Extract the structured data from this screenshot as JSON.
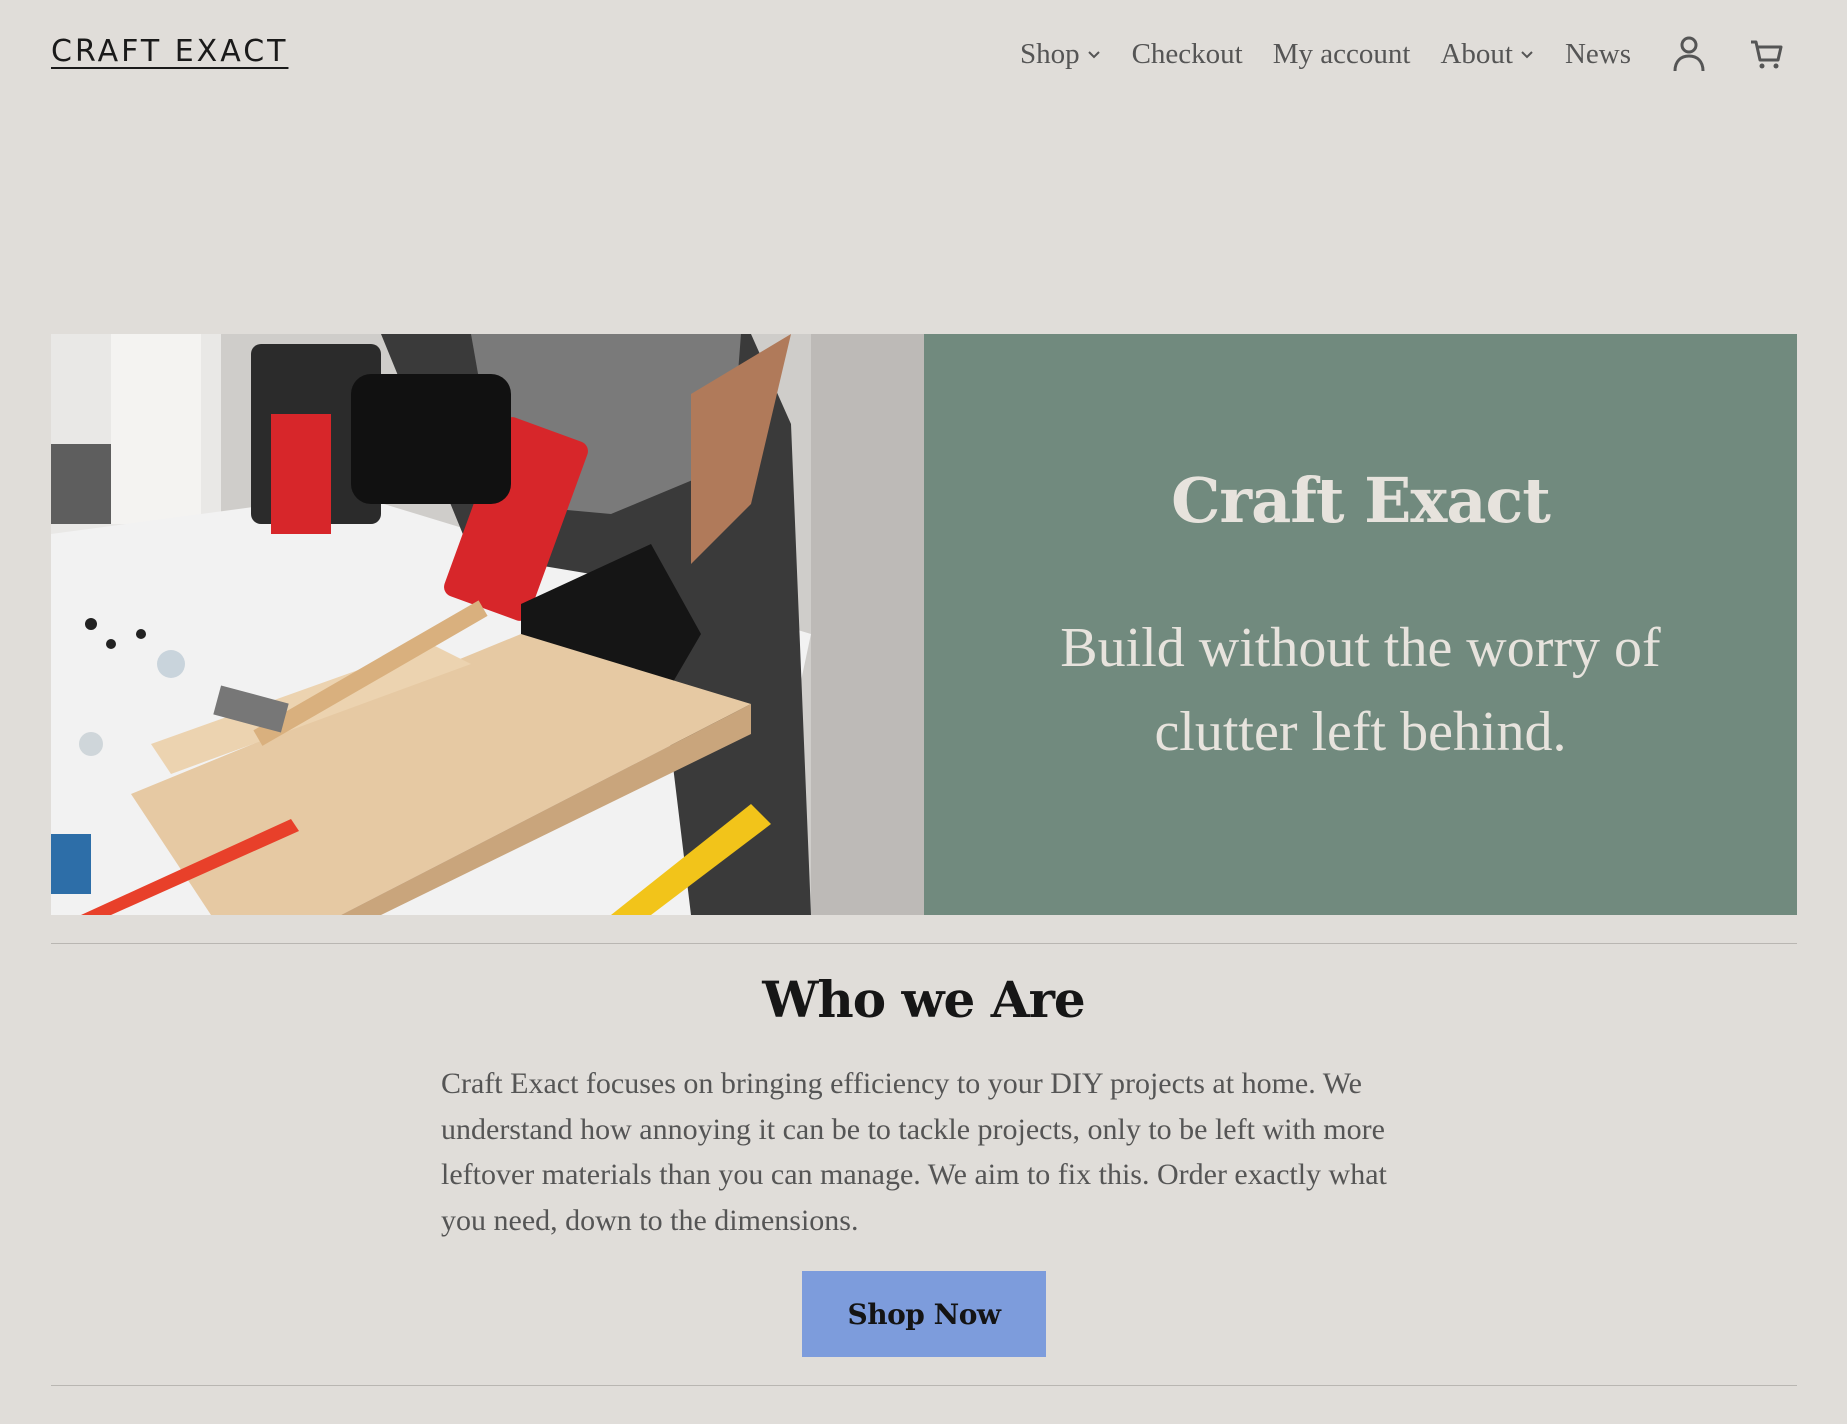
{
  "header": {
    "site_title": "CRAFT EXACT",
    "nav": {
      "shop": "Shop",
      "checkout": "Checkout",
      "my_account": "My account",
      "about": "About",
      "news": "News"
    },
    "icons": [
      "user-icon",
      "cart-icon",
      "chevron-down-icon"
    ]
  },
  "hero": {
    "title": "Craft Exact",
    "tagline": "Build without the worry of clutter left behind.",
    "image_alt": "Person drilling screws into wooden planks on a workbench"
  },
  "about": {
    "heading": "Who we Are",
    "body": "Craft Exact focuses on bringing efficiency to your DIY projects at home. We understand how annoying it can be to tackle projects, only to be left with more leftover materials than you can manage. We aim to fix this. Order exactly what you need, down to the dimensions.",
    "cta": "Shop Now"
  },
  "colors": {
    "background": "#e0ddd9",
    "hero_panel": "#718a7e",
    "button": "#7d9cdc",
    "text": "#555555"
  }
}
